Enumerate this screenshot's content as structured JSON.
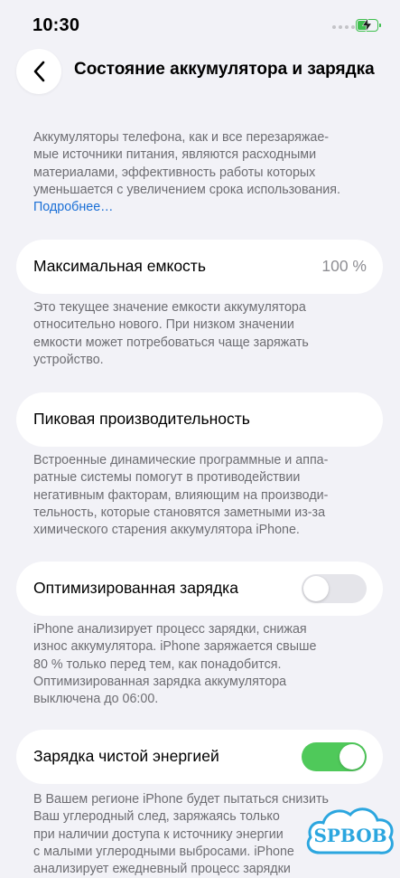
{
  "status_bar": {
    "time": "10:30"
  },
  "nav": {
    "title": "Состояние аккумулятора и зарядка"
  },
  "intro": {
    "lines": [
      "Аккумуляторы телефона, как и все перезаряжае-",
      "мые источники питания, являются расходными",
      "материалами, эффективность работы которых",
      "уменьшается с увеличением срока использования."
    ],
    "link": "Подробнее…"
  },
  "max_capacity": {
    "label": "Максимальная емкость",
    "value": "100 %",
    "lines": [
      "Это текущее значение емкости аккумулятора",
      "относительно нового. При низком значении",
      "емкости может потребоваться чаще заряжать",
      "устройство."
    ]
  },
  "peak_performance": {
    "label": "Пиковая производительность",
    "lines": [
      "Встроенные динамические программные и аппа-",
      "ратные системы помогут в противодействии",
      "негативным факторам, влияющим на производи-",
      "тельность, которые становятся заметными из-за",
      "химического старения аккумулятора iPhone."
    ]
  },
  "optimized_charging": {
    "label": "Оптимизированная зарядка",
    "enabled": false,
    "lines": [
      "iPhone анализирует процесс зарядки, снижая",
      "износ аккумулятора. iPhone заряжается свыше",
      "80 % только перед тем, как понадобится.",
      "Оптимизированная зарядка аккумулятора",
      "выключена до 06:00."
    ]
  },
  "clean_energy": {
    "label": "Зарядка чистой энергией",
    "enabled": true,
    "lines": [
      "В Вашем регионе iPhone будет пытаться снизить",
      "Ваш углеродный след, заряжаясь только",
      "при наличии доступа к источнику энергии",
      "с малыми углеродными выбросами. iPhone",
      "анализирует ежедневный процесс зарядки"
    ]
  },
  "watermark": {
    "text": "SPBOB"
  },
  "colors": {
    "background": "#f2f2f7",
    "link": "#1a6fd6",
    "toggle_on": "#4fc95a",
    "toggle_off": "#e5e5ea",
    "battery": "#3fbf4e"
  }
}
